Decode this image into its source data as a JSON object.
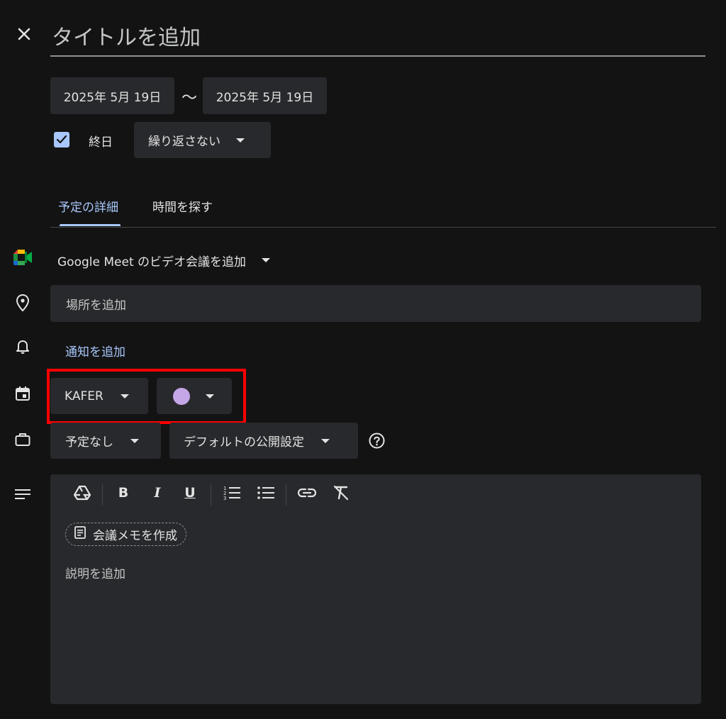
{
  "colors": {
    "background": "#131314",
    "surface": "#28292c",
    "accent": "#a8c7fa",
    "checkbox": "#a8c7fa",
    "event_color": "#c5a7e8",
    "highlight": "#ff0000"
  },
  "header": {
    "title_placeholder": "タイトルを追加"
  },
  "dates": {
    "start": "2025年 5月 19日",
    "separator": "〜",
    "end": "2025年 5月 19日"
  },
  "allday": {
    "label": "終日",
    "checked": true
  },
  "repeat": {
    "value": "繰り返さない"
  },
  "tabs": [
    {
      "label": "予定の詳細",
      "active": true
    },
    {
      "label": "時間を探す",
      "active": false
    }
  ],
  "meet": {
    "label": "Google Meet のビデオ会議を追加"
  },
  "location": {
    "placeholder": "場所を追加"
  },
  "notification": {
    "label": "通知を追加"
  },
  "calendar": {
    "name": "KAFER"
  },
  "busy": {
    "value": "予定なし"
  },
  "visibility": {
    "value": "デフォルトの公開設定"
  },
  "description": {
    "toolbar": [
      "drive-icon",
      "bold-icon",
      "italic-icon",
      "underline-icon",
      "numbered-list-icon",
      "bulleted-list-icon",
      "link-icon",
      "clear-format-icon"
    ],
    "notes_button": "会議メモを作成",
    "placeholder": "説明を追加"
  }
}
